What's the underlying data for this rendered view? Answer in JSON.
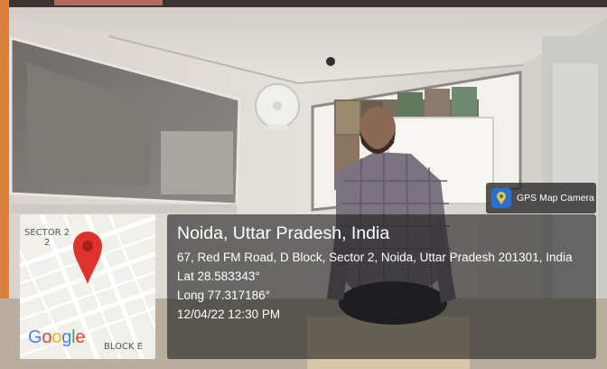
{
  "badge": {
    "label": "GPS Map Camera",
    "icon": "map-pin-icon",
    "color": "#2a6fd6"
  },
  "map": {
    "sector_label_line1": "SECTOR 2",
    "sector_label_line2": "2",
    "block_label": "BLOCK E",
    "logo_letters": [
      {
        "char": "G",
        "color": "#4285F4"
      },
      {
        "char": "o",
        "color": "#EA4335"
      },
      {
        "char": "o",
        "color": "#FBBC05"
      },
      {
        "char": "g",
        "color": "#4285F4"
      },
      {
        "char": "l",
        "color": "#34A853"
      },
      {
        "char": "e",
        "color": "#EA4335"
      }
    ],
    "pin_color": "#e0322d"
  },
  "info": {
    "title": "Noida, Uttar Pradesh, India",
    "address": "67, Red FM Road, D Block, Sector 2, Noida, Uttar Pradesh 201301, India",
    "latitude": "Lat 28.583343°",
    "longitude": "Long 77.317186°",
    "datetime": "12/04/22 12:30 PM"
  }
}
